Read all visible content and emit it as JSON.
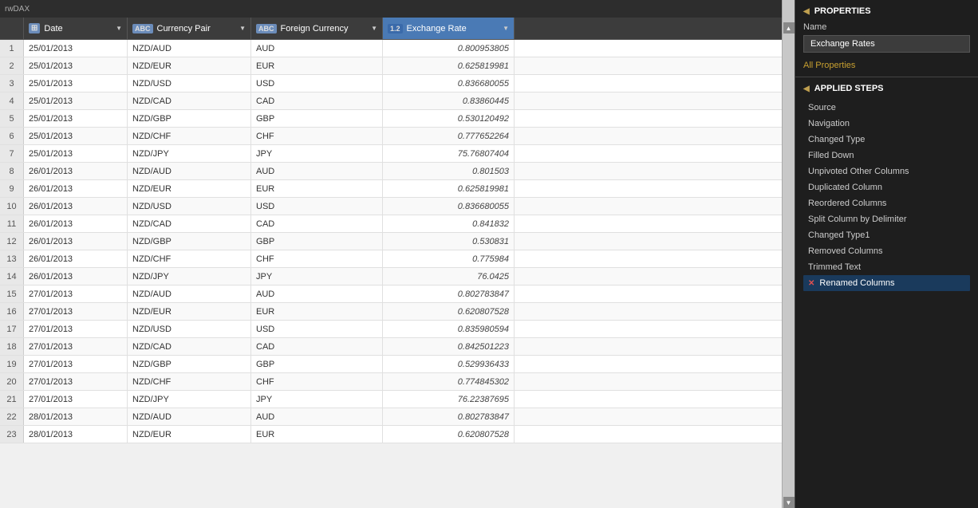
{
  "topbar": {
    "app_label": "rwDAX"
  },
  "columns": [
    {
      "id": "date",
      "label": "Date",
      "type": "date",
      "type_icon": "📅",
      "type_code": "⊞"
    },
    {
      "id": "pair",
      "label": "Currency Pair",
      "type": "text",
      "type_code": "ABC"
    },
    {
      "id": "foreign",
      "label": "Foreign Currency",
      "type": "text",
      "type_code": "ABC"
    },
    {
      "id": "rate",
      "label": "Exchange Rate",
      "type": "numeric",
      "type_code": "1.2",
      "active": true
    }
  ],
  "rows": [
    {
      "num": 1,
      "date": "25/01/2013",
      "pair": "NZD/AUD",
      "foreign": "AUD",
      "rate": "0.800953805"
    },
    {
      "num": 2,
      "date": "25/01/2013",
      "pair": "NZD/EUR",
      "foreign": "EUR",
      "rate": "0.625819981"
    },
    {
      "num": 3,
      "date": "25/01/2013",
      "pair": "NZD/USD",
      "foreign": "USD",
      "rate": "0.836680055"
    },
    {
      "num": 4,
      "date": "25/01/2013",
      "pair": "NZD/CAD",
      "foreign": "CAD",
      "rate": "0.83860445"
    },
    {
      "num": 5,
      "date": "25/01/2013",
      "pair": "NZD/GBP",
      "foreign": "GBP",
      "rate": "0.530120492"
    },
    {
      "num": 6,
      "date": "25/01/2013",
      "pair": "NZD/CHF",
      "foreign": "CHF",
      "rate": "0.777652264"
    },
    {
      "num": 7,
      "date": "25/01/2013",
      "pair": "NZD/JPY",
      "foreign": "JPY",
      "rate": "75.76807404"
    },
    {
      "num": 8,
      "date": "26/01/2013",
      "pair": "NZD/AUD",
      "foreign": "AUD",
      "rate": "0.801503"
    },
    {
      "num": 9,
      "date": "26/01/2013",
      "pair": "NZD/EUR",
      "foreign": "EUR",
      "rate": "0.625819981"
    },
    {
      "num": 10,
      "date": "26/01/2013",
      "pair": "NZD/USD",
      "foreign": "USD",
      "rate": "0.836680055"
    },
    {
      "num": 11,
      "date": "26/01/2013",
      "pair": "NZD/CAD",
      "foreign": "CAD",
      "rate": "0.841832"
    },
    {
      "num": 12,
      "date": "26/01/2013",
      "pair": "NZD/GBP",
      "foreign": "GBP",
      "rate": "0.530831"
    },
    {
      "num": 13,
      "date": "26/01/2013",
      "pair": "NZD/CHF",
      "foreign": "CHF",
      "rate": "0.775984"
    },
    {
      "num": 14,
      "date": "26/01/2013",
      "pair": "NZD/JPY",
      "foreign": "JPY",
      "rate": "76.0425"
    },
    {
      "num": 15,
      "date": "27/01/2013",
      "pair": "NZD/AUD",
      "foreign": "AUD",
      "rate": "0.802783847"
    },
    {
      "num": 16,
      "date": "27/01/2013",
      "pair": "NZD/EUR",
      "foreign": "EUR",
      "rate": "0.620807528"
    },
    {
      "num": 17,
      "date": "27/01/2013",
      "pair": "NZD/USD",
      "foreign": "USD",
      "rate": "0.835980594"
    },
    {
      "num": 18,
      "date": "27/01/2013",
      "pair": "NZD/CAD",
      "foreign": "CAD",
      "rate": "0.842501223"
    },
    {
      "num": 19,
      "date": "27/01/2013",
      "pair": "NZD/GBP",
      "foreign": "GBP",
      "rate": "0.529936433"
    },
    {
      "num": 20,
      "date": "27/01/2013",
      "pair": "NZD/CHF",
      "foreign": "CHF",
      "rate": "0.774845302"
    },
    {
      "num": 21,
      "date": "27/01/2013",
      "pair": "NZD/JPY",
      "foreign": "JPY",
      "rate": "76.22387695"
    },
    {
      "num": 22,
      "date": "28/01/2013",
      "pair": "NZD/AUD",
      "foreign": "AUD",
      "rate": "0.802783847"
    },
    {
      "num": 23,
      "date": "28/01/2013",
      "pair": "NZD/EUR",
      "foreign": "EUR",
      "rate": "0.620807528"
    }
  ],
  "properties": {
    "section_title": "PROPERTIES",
    "name_label": "Name",
    "name_value": "Exchange Rates",
    "all_properties_link": "All Properties"
  },
  "applied_steps": {
    "section_title": "APPLIED STEPS",
    "steps": [
      {
        "id": "source",
        "label": "Source",
        "active": false,
        "has_error": false
      },
      {
        "id": "navigation",
        "label": "Navigation",
        "active": false,
        "has_error": false
      },
      {
        "id": "changed_type",
        "label": "Changed Type",
        "active": false,
        "has_error": false
      },
      {
        "id": "filled_down",
        "label": "Filled Down",
        "active": false,
        "has_error": false
      },
      {
        "id": "unpivoted_other_columns",
        "label": "Unpivoted Other Columns",
        "active": false,
        "has_error": false
      },
      {
        "id": "duplicated_column",
        "label": "Duplicated Column",
        "active": false,
        "has_error": false
      },
      {
        "id": "reordered_columns",
        "label": "Reordered Columns",
        "active": false,
        "has_error": false
      },
      {
        "id": "split_column",
        "label": "Split Column by Delimiter",
        "active": false,
        "has_error": false
      },
      {
        "id": "changed_type1",
        "label": "Changed Type1",
        "active": false,
        "has_error": false
      },
      {
        "id": "removed_columns",
        "label": "Removed Columns",
        "active": false,
        "has_error": false
      },
      {
        "id": "trimmed_text",
        "label": "Trimmed Text",
        "active": false,
        "has_error": false
      },
      {
        "id": "renamed_columns",
        "label": "Renamed Columns",
        "active": true,
        "has_error": true
      }
    ]
  }
}
